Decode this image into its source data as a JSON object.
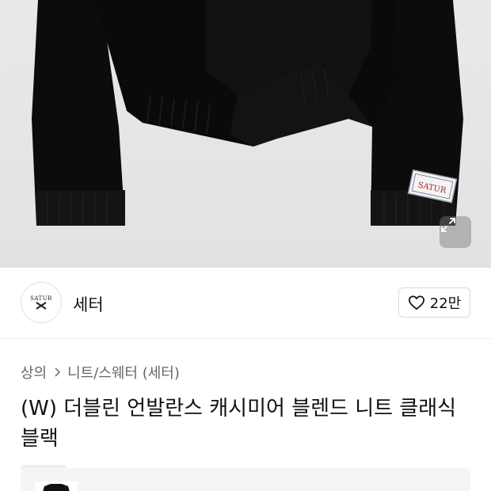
{
  "product_image": {
    "icons": {
      "zoom": "expand-arrows-icon"
    },
    "label_text": "SATUR"
  },
  "brand": {
    "logo_text": "SATUR",
    "logo_icon": "crossed-hands-logo-icon",
    "name": "세터"
  },
  "like": {
    "icon": "heart-outline-icon",
    "count": "22만"
  },
  "breadcrumb": {
    "items": [
      "상의",
      "니트/스웨터 (세터)"
    ],
    "separator_icon": "chevron-right-icon"
  },
  "product": {
    "title": "(W) 더블린 언발란스 캐시미어 블렌드 니트 클래식 블랙"
  }
}
